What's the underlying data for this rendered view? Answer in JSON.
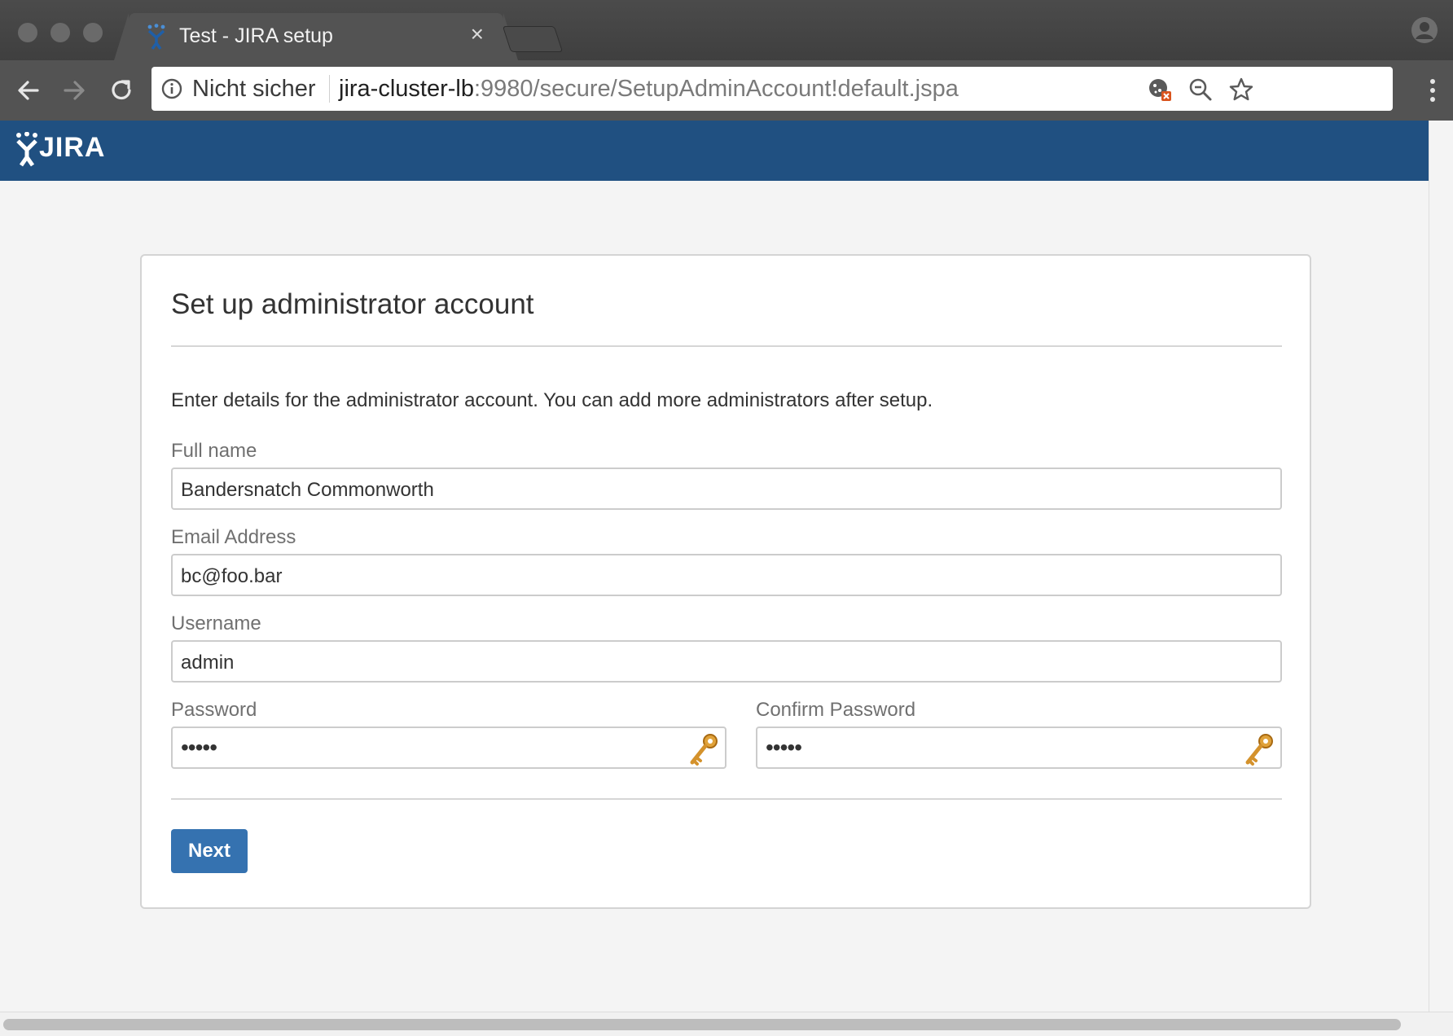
{
  "browser": {
    "tab_title": "Test - JIRA setup",
    "tab_close": "×",
    "security_label": "Nicht sicher",
    "url_host": "jira-cluster-lb",
    "url_rest": ":9980/secure/SetupAdminAccount!default.jspa",
    "icons": {
      "back": "back-arrow-icon",
      "forward": "forward-arrow-icon",
      "reload": "reload-icon",
      "info": "info-icon",
      "cookie_blocked": "cookie-blocked-icon",
      "zoom": "zoom-out-icon",
      "bookmark": "star-icon",
      "menu": "more-vertical-icon",
      "profile": "profile-icon"
    }
  },
  "header": {
    "logo_text": "JIRA"
  },
  "form": {
    "title": "Set up administrator account",
    "intro": "Enter details for the administrator account. You can add more administrators after setup.",
    "full_name": {
      "label": "Full name",
      "value": "Bandersnatch Commonworth"
    },
    "email": {
      "label": "Email Address",
      "value": "bc@foo.bar"
    },
    "username": {
      "label": "Username",
      "value": "admin"
    },
    "password": {
      "label": "Password",
      "value": "•••••"
    },
    "confirm_password": {
      "label": "Confirm Password",
      "value": "•••••"
    },
    "next_label": "Next"
  },
  "colors": {
    "header_blue": "#205081",
    "button_blue": "#3572b0",
    "page_bg": "#f4f4f4"
  }
}
